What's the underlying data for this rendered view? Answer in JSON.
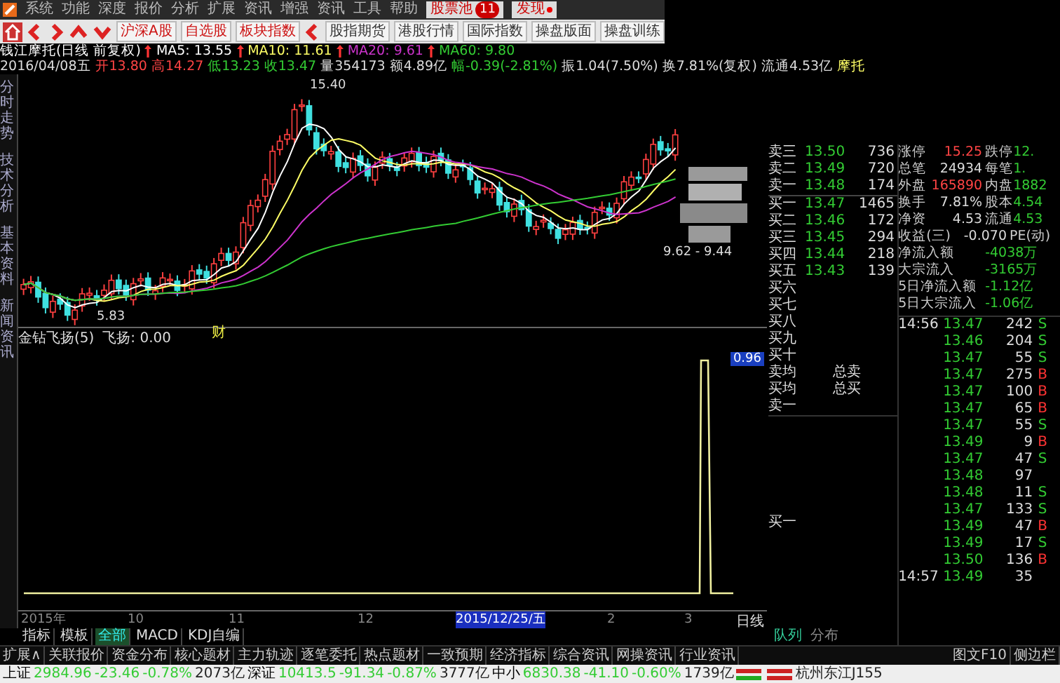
{
  "menu": {
    "items": [
      "系统",
      "功能",
      "深度",
      "报价",
      "分析",
      "扩展",
      "资讯",
      "增强",
      "资讯",
      "工具",
      "帮助"
    ],
    "pool": {
      "label": "股票池",
      "badge": "11"
    },
    "discover": {
      "label": "发现",
      "dot": true
    }
  },
  "toolbar": {
    "market_buttons": [
      "沪深A股",
      "自选股",
      "板块指数"
    ],
    "more_buttons": [
      "股指期货",
      "港股行情",
      "国际指数",
      "操盘版面",
      "操盘训练"
    ]
  },
  "info": {
    "name": "钱江摩托(日线 前复权)",
    "mas": [
      {
        "label": "MA5: 13.55",
        "color": "#ffffff"
      },
      {
        "label": "MA10: 11.61",
        "color": "#ffff66"
      },
      {
        "label": "MA20: 9.61",
        "color": "#cc33cc"
      },
      {
        "label": "MA60: 9.80",
        "color": "#33cc33"
      }
    ],
    "quote": [
      {
        "text": "2016/04/08五",
        "color": "#dddddd"
      },
      {
        "text": "开13.80",
        "color": "#ff4444"
      },
      {
        "text": "高14.27",
        "color": "#ff4444"
      },
      {
        "text": "低13.23",
        "color": "#33cc33"
      },
      {
        "text": "收13.47",
        "color": "#33cc33"
      },
      {
        "text": "量354173",
        "color": "#dddddd"
      },
      {
        "text": "额4.89亿",
        "color": "#dddddd"
      },
      {
        "text": "幅-0.39(-2.81%)",
        "color": "#33cc33"
      },
      {
        "text": "振1.04(7.50%)",
        "color": "#dddddd"
      },
      {
        "text": "换7.81%(复权)",
        "color": "#dddddd"
      },
      {
        "text": "流通4.53亿",
        "color": "#dddddd"
      },
      {
        "text": "摩托",
        "color": "#ffff66"
      }
    ]
  },
  "side_tabs": [
    "分时走势",
    "技术分析",
    "基本资料",
    "新闻资讯"
  ],
  "chart": {
    "high_label": "15.40",
    "low_label": "5.83",
    "range_label": "9.62 - 9.44",
    "marker": "财"
  },
  "indicator": {
    "title": "金钻飞扬(5)",
    "reading": "飞扬: 0.00",
    "axis_label": "0.96"
  },
  "date_axis": {
    "labels": [
      "2015年",
      "10",
      "11",
      "12",
      "2015/12/25/五",
      "2",
      "3"
    ],
    "period": "日线"
  },
  "index_tabs": [
    {
      "label": "指标",
      "selected": false
    },
    {
      "label": "模板",
      "selected": false
    },
    {
      "label": "全部",
      "selected": true
    },
    {
      "label": "MACD",
      "selected": false
    },
    {
      "label": "KDJ自编",
      "selected": false
    }
  ],
  "order_book": [
    {
      "label": "卖三",
      "price": "13.50",
      "volume": "736"
    },
    {
      "label": "卖二",
      "price": "13.49",
      "volume": "720"
    },
    {
      "label": "卖一",
      "price": "13.48",
      "volume": "174"
    },
    {
      "label": "买一",
      "price": "13.47",
      "volume": "1465"
    },
    {
      "label": "买二",
      "price": "13.46",
      "volume": "172"
    },
    {
      "label": "买三",
      "price": "13.45",
      "volume": "294"
    },
    {
      "label": "买四",
      "price": "13.44",
      "volume": "218"
    },
    {
      "label": "买五",
      "price": "13.43",
      "volume": "139"
    },
    {
      "label": "买六"
    },
    {
      "label": "买七"
    },
    {
      "label": "买八"
    },
    {
      "label": "买九"
    },
    {
      "label": "买十"
    }
  ],
  "averages": [
    {
      "label": "卖均",
      "total": "总卖"
    },
    {
      "label": "买均",
      "total": "总买"
    }
  ],
  "queue_labels": [
    "卖一",
    "买一"
  ],
  "stats": [
    {
      "l1": "涨停",
      "v1": "15.25",
      "l2": "跌停",
      "v2": "12."
    },
    {
      "l1": "总笔",
      "v1": "24934",
      "l2": "每笔",
      "v2": "1."
    },
    {
      "l1": "外盘",
      "v1": "165890",
      "l2": "内盘",
      "v2": "1882"
    },
    {
      "l1": "换手",
      "v1": "7.81%",
      "l2": "股本",
      "v2": "4.54"
    },
    {
      "l1": "净资",
      "v1": "4.53",
      "l2": "流通",
      "v2": "4.53"
    },
    {
      "l1": "收益(三)",
      "v1": "-0.070",
      "l2": "PE(动)"
    }
  ],
  "flows": [
    {
      "label": "净流入额",
      "value": "-4038万"
    },
    {
      "label": "大宗流入",
      "value": "-3165万"
    },
    {
      "label": "5日净流入额",
      "value": "-1.12亿"
    },
    {
      "label": "5日大宗流入",
      "value": "-1.06亿"
    }
  ],
  "ticks": [
    {
      "time": "14:56",
      "price": "13.47",
      "volume": "242",
      "side": "S",
      "kind": "sell"
    },
    {
      "price": "13.46",
      "volume": "204",
      "side": "S",
      "kind": "sell"
    },
    {
      "price": "13.47",
      "volume": "55",
      "side": "S",
      "kind": "sell"
    },
    {
      "price": "13.47",
      "volume": "275",
      "side": "B",
      "kind": "buy"
    },
    {
      "price": "13.47",
      "volume": "100",
      "side": "B",
      "kind": "buy"
    },
    {
      "price": "13.47",
      "volume": "65",
      "side": "B",
      "kind": "buy"
    },
    {
      "price": "13.47",
      "volume": "55",
      "side": "S",
      "kind": "sell"
    },
    {
      "price": "13.49",
      "volume": "9",
      "side": "B",
      "kind": "buy"
    },
    {
      "price": "13.47",
      "volume": "47",
      "side": "S",
      "kind": "sell"
    },
    {
      "price": "13.48",
      "volume": "97"
    },
    {
      "price": "13.48",
      "volume": "11",
      "side": "S",
      "kind": "sell"
    },
    {
      "price": "13.47",
      "volume": "133",
      "side": "S",
      "kind": "sell"
    },
    {
      "price": "13.49",
      "volume": "47",
      "side": "B",
      "kind": "buy"
    },
    {
      "price": "13.49",
      "volume": "17",
      "side": "S",
      "kind": "sell"
    },
    {
      "price": "13.50",
      "volume": "136",
      "side": "B",
      "kind": "buy"
    },
    {
      "time": "14:57",
      "price": "13.49",
      "volume": "35"
    }
  ],
  "right_tabs": [
    {
      "label": "队列",
      "selected": true
    },
    {
      "label": "分布",
      "selected": false
    }
  ],
  "bottom_tabs": [
    "扩展∧",
    "关联报价",
    "资金分布",
    "核心题材",
    "主力轨迹",
    "逐笔委托",
    "热点题材",
    "一致预期",
    "经济指标",
    "综合资讯",
    "网操资讯",
    "行业资讯"
  ],
  "bottom_right": [
    "图文F10",
    "侧边栏"
  ],
  "status": [
    {
      "text": "上证",
      "color": "#000000"
    },
    {
      "text": "2984.96",
      "color": "#33cc33"
    },
    {
      "text": "-23.46",
      "color": "#33cc33"
    },
    {
      "text": "-0.78%",
      "color": "#33cc33"
    },
    {
      "text": "2073亿",
      "color": "#222222"
    },
    {
      "text": "深证",
      "color": "#000000"
    },
    {
      "text": "10413.5",
      "color": "#33cc33"
    },
    {
      "text": "-91.34",
      "color": "#33cc33"
    },
    {
      "text": "-0.87%",
      "color": "#33cc33"
    },
    {
      "text": "3777亿",
      "color": "#222222"
    },
    {
      "text": "中小",
      "color": "#000000"
    },
    {
      "text": "6830.38",
      "color": "#33cc33"
    },
    {
      "text": "-41.10",
      "color": "#33cc33"
    },
    {
      "text": "-0.60%",
      "color": "#33cc33"
    },
    {
      "text": "1739亿",
      "color": "#222222"
    }
  ],
  "status_right": "杭州东江J155"
}
